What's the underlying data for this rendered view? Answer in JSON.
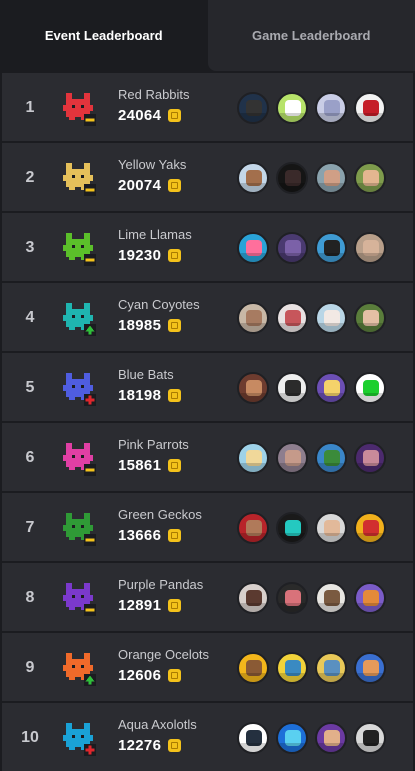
{
  "tabs": [
    {
      "label": "Event Leaderboard",
      "active": true
    },
    {
      "label": "Game Leaderboard",
      "active": false
    }
  ],
  "icons": {
    "coin": "gold-coin-icon"
  },
  "rows": [
    {
      "rank": "1",
      "name": "Red Rabbits",
      "score": "24064",
      "color": "#e2343c",
      "badge": "minus",
      "avatars": [
        {
          "bg": "#20324a",
          "face": "#333"
        },
        {
          "bg": "#b7e36a",
          "face": "#fff"
        },
        {
          "bg": "#c9cde6",
          "face": "#9aa0c8"
        },
        {
          "bg": "#f2f2f2",
          "face": "#c51d28"
        }
      ]
    },
    {
      "rank": "2",
      "name": "Yellow Yaks",
      "score": "20074",
      "color": "#e5c05a",
      "badge": "minus",
      "avatars": [
        {
          "bg": "#c4d7e8",
          "face": "#a36f4c"
        },
        {
          "bg": "#151515",
          "face": "#3a2a2a"
        },
        {
          "bg": "#8aa2ad",
          "face": "#d09f86"
        },
        {
          "bg": "#7e9b4c",
          "face": "#e3b690"
        }
      ]
    },
    {
      "rank": "3",
      "name": "Lime Llamas",
      "score": "19230",
      "color": "#5bbf2a",
      "badge": "minus",
      "avatars": [
        {
          "bg": "#2aa3d8",
          "face": "#ff6f9c"
        },
        {
          "bg": "#4a3a70",
          "face": "#7b61a8"
        },
        {
          "bg": "#3f9bd3",
          "face": "#222"
        },
        {
          "bg": "#b89f8a",
          "face": "#d6b39a"
        }
      ]
    },
    {
      "rank": "4",
      "name": "Cyan Coyotes",
      "score": "18985",
      "color": "#1fb5b0",
      "badge": "up",
      "avatars": [
        {
          "bg": "#c8b8a6",
          "face": "#a77b61"
        },
        {
          "bg": "#e9e2e2",
          "face": "#c7565b"
        },
        {
          "bg": "#b9d6e6",
          "face": "#f2e9e4"
        },
        {
          "bg": "#5a7d3b",
          "face": "#e4c0a5"
        }
      ]
    },
    {
      "rank": "5",
      "name": "Blue Bats",
      "score": "18198",
      "color": "#4f5de0",
      "badge": "plus",
      "avatars": [
        {
          "bg": "#6e3c2f",
          "face": "#c78a62"
        },
        {
          "bg": "#eeeeee",
          "face": "#2b2b2b"
        },
        {
          "bg": "#6c4fb4",
          "face": "#f4d26a"
        },
        {
          "bg": "#ffffff",
          "face": "#1ccf2e"
        }
      ]
    },
    {
      "rank": "6",
      "name": "Pink Parrots",
      "score": "15861",
      "color": "#e03fa4",
      "badge": "minus",
      "avatars": [
        {
          "bg": "#9ed2e8",
          "face": "#f0d89a"
        },
        {
          "bg": "#8e7e8e",
          "face": "#c59a8a"
        },
        {
          "bg": "#3a86c8",
          "face": "#3b8b3a"
        },
        {
          "bg": "#4c2a6e",
          "face": "#c98a9a"
        }
      ]
    },
    {
      "rank": "7",
      "name": "Green Geckos",
      "score": "13666",
      "color": "#2f9a36",
      "badge": "minus",
      "avatars": [
        {
          "bg": "#b8242a",
          "face": "#b07a5a"
        },
        {
          "bg": "#1a1a1a",
          "face": "#24c9c0"
        },
        {
          "bg": "#d8d8d8",
          "face": "#e2b99a"
        },
        {
          "bg": "#f1b01c",
          "face": "#d12f2f"
        }
      ]
    },
    {
      "rank": "8",
      "name": "Purple Pandas",
      "score": "12891",
      "color": "#7b39cc",
      "badge": "minus",
      "avatars": [
        {
          "bg": "#d8d0cc",
          "face": "#5b3a30"
        },
        {
          "bg": "#2a2a2a",
          "face": "#d9727a"
        },
        {
          "bg": "#e8e6e2",
          "face": "#7a5a40"
        },
        {
          "bg": "#7b5cc8",
          "face": "#e48a3a"
        }
      ]
    },
    {
      "rank": "9",
      "name": "Orange Ocelots",
      "score": "12606",
      "color": "#f06a2a",
      "badge": "up",
      "avatars": [
        {
          "bg": "#f3b61b",
          "face": "#8a5a35"
        },
        {
          "bg": "#f2d33a",
          "face": "#3a8ac2"
        },
        {
          "bg": "#e8c858",
          "face": "#5a90c0"
        },
        {
          "bg": "#3a6fd0",
          "face": "#e59a5a"
        }
      ]
    },
    {
      "rank": "10",
      "name": "Aqua Axolotls",
      "score": "12276",
      "color": "#1aa2d6",
      "badge": "plus",
      "avatars": [
        {
          "bg": "#ffffff",
          "face": "#24303f"
        },
        {
          "bg": "#1d6fd8",
          "face": "#5ad0f0"
        },
        {
          "bg": "#6b3aa2",
          "face": "#e2b08a"
        },
        {
          "bg": "#d8d8d8",
          "face": "#222"
        }
      ]
    }
  ]
}
